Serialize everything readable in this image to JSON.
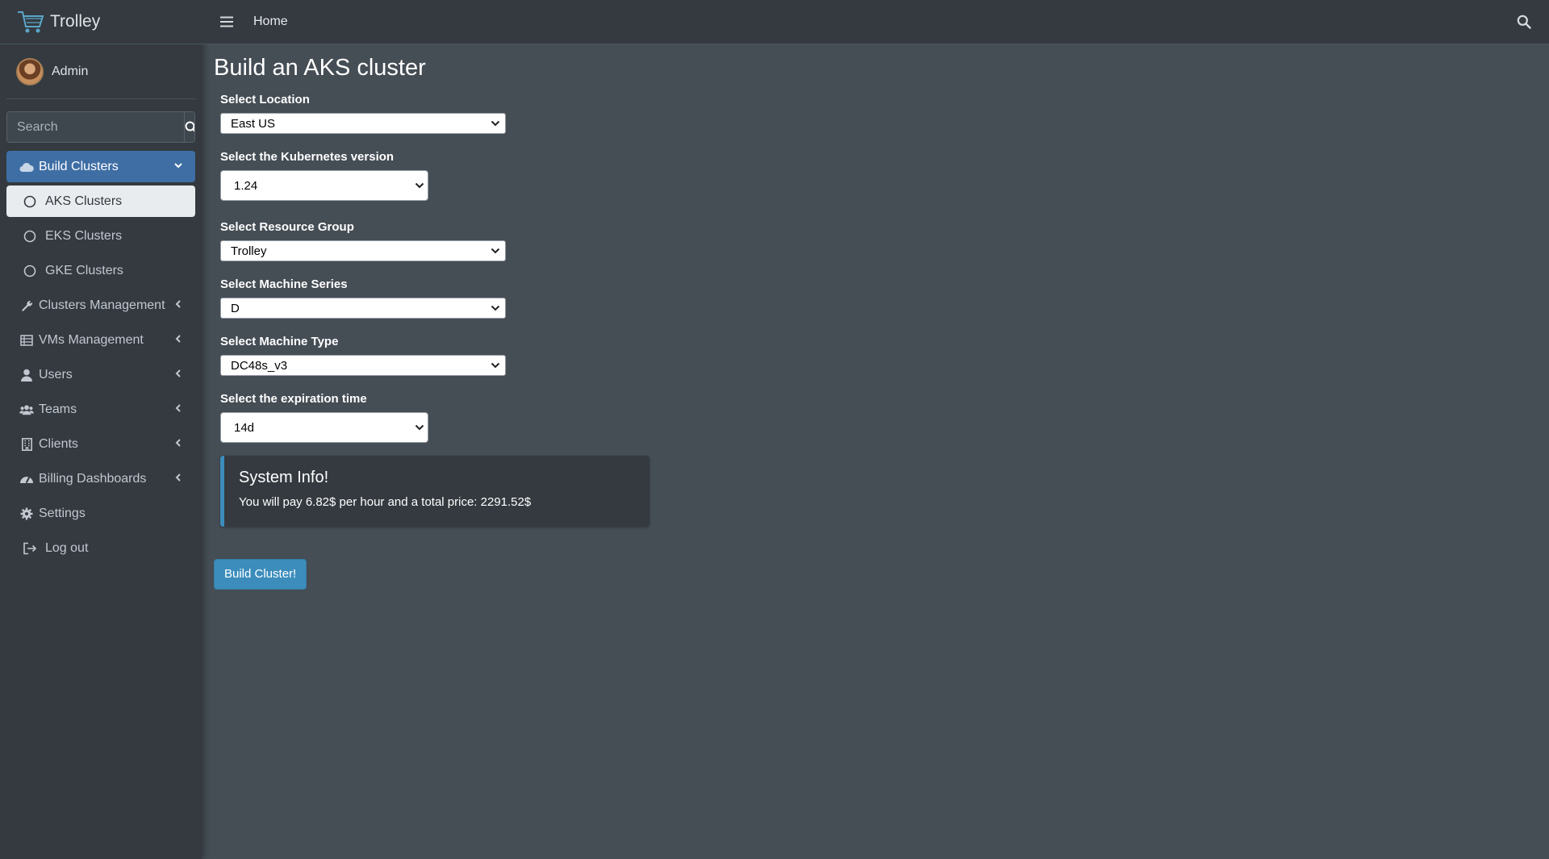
{
  "brand": {
    "name": "Trolley"
  },
  "user": {
    "name": "Admin"
  },
  "sidebar": {
    "search_placeholder": "Search",
    "items": [
      {
        "label": "Build Clusters",
        "icon": "cloud-icon",
        "state": "open"
      },
      {
        "label": "AKS Clusters",
        "icon": "circle-icon",
        "state": "active"
      },
      {
        "label": "EKS Clusters",
        "icon": "circle-icon"
      },
      {
        "label": "GKE Clusters",
        "icon": "circle-icon"
      },
      {
        "label": "Clusters Management",
        "icon": "wrench-icon"
      },
      {
        "label": "VMs Management",
        "icon": "list-icon"
      },
      {
        "label": "Users",
        "icon": "user-icon"
      },
      {
        "label": "Teams",
        "icon": "users-icon"
      },
      {
        "label": "Clients",
        "icon": "building-icon"
      },
      {
        "label": "Billing Dashboards",
        "icon": "gauge-icon"
      },
      {
        "label": "Settings",
        "icon": "gear-icon"
      },
      {
        "label": "Log out",
        "icon": "logout-icon"
      }
    ]
  },
  "topbar": {
    "home_label": "Home"
  },
  "page": {
    "title": "Build an AKS cluster"
  },
  "form": {
    "location": {
      "label": "Select Location",
      "value": "East US"
    },
    "k8s_version": {
      "label": "Select the Kubernetes version",
      "value": "1.24"
    },
    "resource_group": {
      "label": "Select Resource Group",
      "value": "Trolley"
    },
    "machine_series": {
      "label": "Select Machine Series",
      "value": "D"
    },
    "machine_type": {
      "label": "Select Machine Type",
      "value": "DC48s_v3"
    },
    "expiration": {
      "label": "Select the expiration time",
      "value": "14d"
    }
  },
  "info": {
    "title": "System Info!",
    "text": "You will pay 6.82$ per hour and a total price: 2291.52$"
  },
  "build_button": {
    "label": "Build Cluster!"
  },
  "colors": {
    "sidebar_bg": "#343a40",
    "content_bg": "#454d55",
    "accent": "#3c8dbc",
    "active_parent": "#3f6ea5"
  }
}
